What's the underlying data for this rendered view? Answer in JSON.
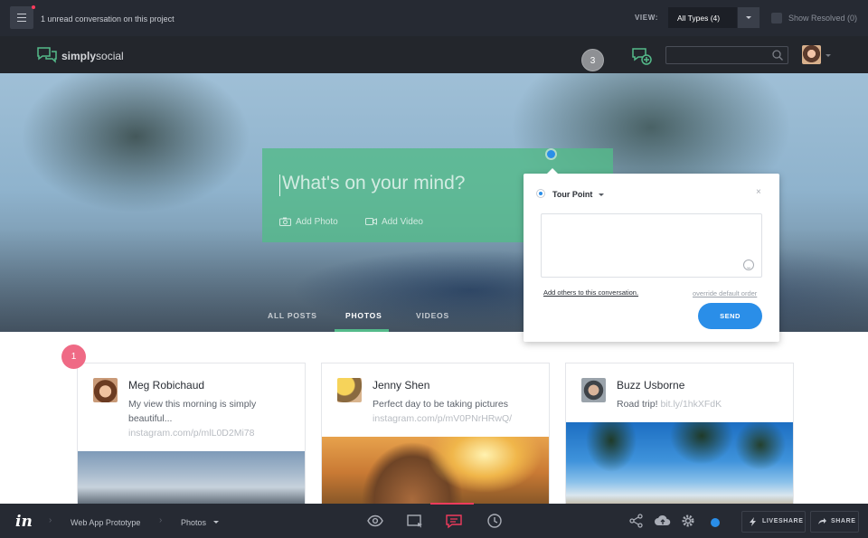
{
  "topbar": {
    "unread_text": "1 unread conversation on this project",
    "view_label": "VIEW:",
    "view_selected": "All Types (4)",
    "show_resolved": "Show Resolved (0)"
  },
  "app": {
    "logo_bold": "simply",
    "logo_light": "social",
    "badge_count": "3"
  },
  "composer": {
    "placeholder": "What's on your mind?",
    "add_photo": "Add Photo",
    "add_video": "Add Video"
  },
  "tabs": [
    {
      "label": "ALL POSTS"
    },
    {
      "label": "PHOTOS"
    },
    {
      "label": "VIDEOS"
    }
  ],
  "tour": {
    "title": "Tour Point",
    "close": "×",
    "add_others": "Add others to this conversation.",
    "override": "override default order",
    "send": "SEND"
  },
  "feed": {
    "badge": "1",
    "posts": [
      {
        "name": "Meg Robichaud",
        "message": "My view this morning is simply beautiful...",
        "link": "instagram.com/p/mlL0D2Mi78"
      },
      {
        "name": "Jenny Shen",
        "message": "Perfect day to be taking pictures",
        "link": "instagram.com/p/mV0PNrHRwQ/"
      },
      {
        "name": "Buzz Usborne",
        "message": "Road trip!",
        "link": "bit.ly/1hkXFdK"
      }
    ]
  },
  "bottombar": {
    "breadcrumb": [
      "Web App Prototype",
      "Photos"
    ],
    "liveshare": "LIVESHARE",
    "share": "SHARE"
  },
  "colors": {
    "accent_green": "#54ba8a",
    "accent_blue": "#2a8ee8",
    "badge_pink": "#ef6a85",
    "chrome_dark": "#262a33"
  }
}
